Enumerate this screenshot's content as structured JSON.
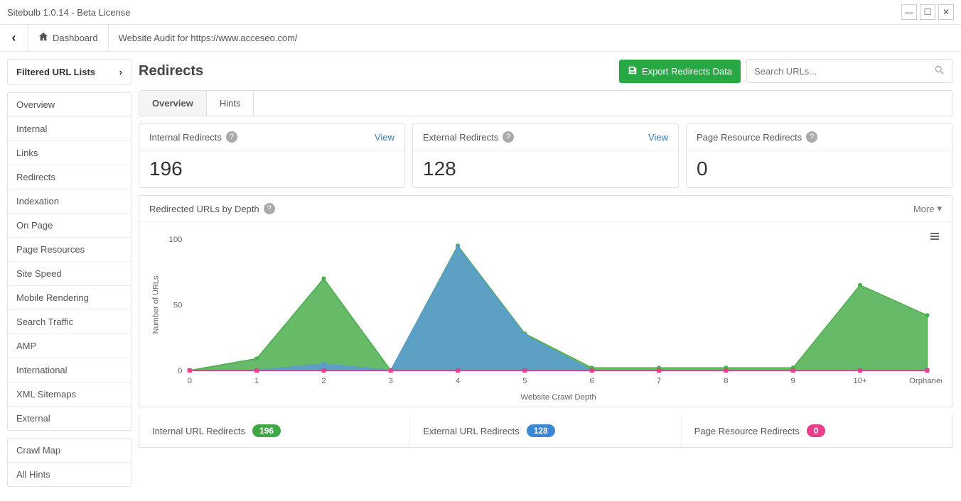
{
  "title": "Sitebulb 1.0.14  - Beta License",
  "window": {
    "min": "—",
    "max": "☐",
    "close": "✕"
  },
  "toolbar": {
    "back_glyph": "‹",
    "dashboard_label": "Dashboard",
    "crumb": "Website Audit for https://www.acceseo.com/"
  },
  "sidebar": {
    "filtered_label": "Filtered URL Lists",
    "nav": [
      "Overview",
      "Internal",
      "Links",
      "Redirects",
      "Indexation",
      "On Page",
      "Page Resources",
      "Site Speed",
      "Mobile Rendering",
      "Search Traffic",
      "AMP",
      "International",
      "XML Sitemaps",
      "External"
    ],
    "extras": [
      "Crawl Map",
      "All Hints"
    ]
  },
  "main": {
    "heading": "Redirects",
    "export_label": "Export Redirects Data",
    "search_placeholder": "Search URLs...",
    "tabs": [
      "Overview",
      "Hints"
    ],
    "cards": [
      {
        "label": "Internal Redirects",
        "value": "196",
        "view": "View"
      },
      {
        "label": "External Redirects",
        "value": "128",
        "view": "View"
      },
      {
        "label": "Page Resource Redirects",
        "value": "0",
        "view": ""
      }
    ],
    "chart_title": "Redirected URLs by Depth",
    "more_label": "More",
    "legend": [
      {
        "label": "Internal URL Redirects",
        "value": "196",
        "class": "pill-green"
      },
      {
        "label": "External URL Redirects",
        "value": "128",
        "class": "pill-blue"
      },
      {
        "label": "Page Resource Redirects",
        "value": "0",
        "class": "pill-pink"
      }
    ]
  },
  "chart_data": {
    "type": "area",
    "title": "Redirected URLs by Depth",
    "xlabel": "Website Crawl Depth",
    "ylabel": "Number of URLs",
    "ylim": [
      0,
      100
    ],
    "yticks": [
      0,
      50,
      100
    ],
    "categories": [
      "0",
      "1",
      "2",
      "3",
      "4",
      "5",
      "6",
      "7",
      "8",
      "9",
      "10+",
      "Orphaned"
    ],
    "series": [
      {
        "name": "Internal URL Redirects",
        "color": "#4cae4c",
        "values": [
          0,
          9,
          70,
          0,
          95,
          28,
          2,
          2,
          2,
          2,
          65,
          42
        ]
      },
      {
        "name": "External URL Redirects",
        "color": "#5b9bd5",
        "values": [
          0,
          0,
          5,
          0,
          94,
          27,
          0,
          0,
          0,
          0,
          0,
          0
        ]
      },
      {
        "name": "Page Resource Redirects",
        "color": "#e83e8c",
        "values": [
          0,
          0,
          0,
          0,
          0,
          0,
          0,
          0,
          0,
          0,
          0,
          0
        ]
      }
    ]
  }
}
